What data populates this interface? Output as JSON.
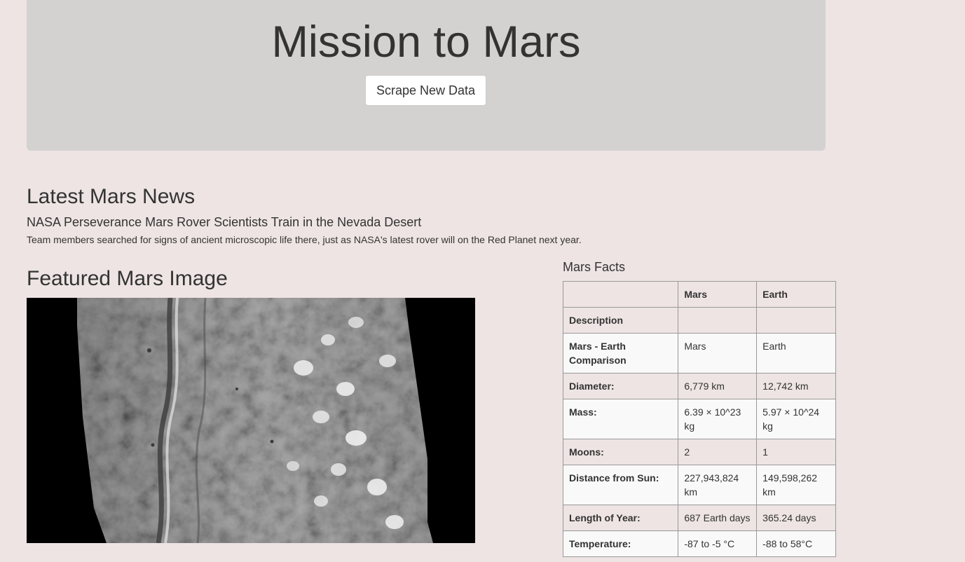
{
  "header": {
    "title": "Mission to Mars",
    "scrape_button_label": "Scrape New Data"
  },
  "news": {
    "heading": "Latest Mars News",
    "title": "NASA Perseverance Mars Rover Scientists Train in the Nevada Desert",
    "teaser": "Team members searched for signs of ancient microscopic life there, just as NASA's latest rover will on the Red Planet next year."
  },
  "featured": {
    "heading": "Featured Mars Image"
  },
  "facts": {
    "heading": "Mars Facts",
    "columns": [
      "",
      "Mars",
      "Earth"
    ],
    "rows": [
      {
        "label": "Description",
        "mars": "",
        "earth": ""
      },
      {
        "label": "Mars - Earth Comparison",
        "mars": "Mars",
        "earth": "Earth"
      },
      {
        "label": "Diameter:",
        "mars": "6,779 km",
        "earth": "12,742 km"
      },
      {
        "label": "Mass:",
        "mars": "6.39 × 10^23 kg",
        "earth": "5.97 × 10^24 kg"
      },
      {
        "label": "Moons:",
        "mars": "2",
        "earth": "1"
      },
      {
        "label": "Distance from Sun:",
        "mars": "227,943,824 km",
        "earth": "149,598,262 km"
      },
      {
        "label": "Length of Year:",
        "mars": "687 Earth days",
        "earth": "365.24 days"
      },
      {
        "label": "Temperature:",
        "mars": "-87 to -5 °C",
        "earth": "-88 to 58°C"
      }
    ]
  },
  "colors": {
    "background": "#ede4e3",
    "jumbotron": "#d3d2d1",
    "text": "#333333"
  }
}
